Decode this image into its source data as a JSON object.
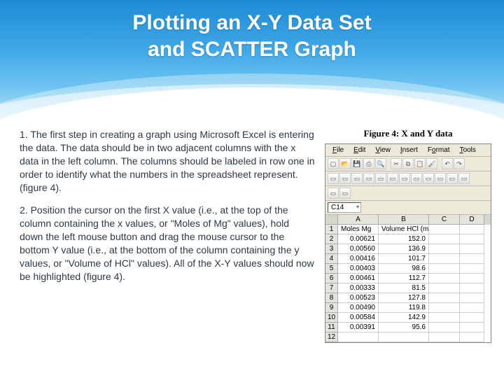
{
  "title_line1": "Plotting an X-Y Data Set",
  "title_line2": "and SCATTER Graph",
  "paragraphs": {
    "p1": "1. The first step in creating a graph using Microsoft Excel is entering the data. The data should be in two adjacent columns with the x data in the left column. The columns should be labeled in row one in order to identify what the numbers in the spreadsheet represent.(figure 4).",
    "p2": "2. Position the cursor on the first X value (i.e., at the top of the column containing the x values, or \"Moles of Mg\" values), hold down the left mouse button and drag the mouse cursor to the bottom Y value (i.e., at the bottom of the column containing the y values, or \"Volume of HCl\" values). All of the X-Y values should now be highlighted (figure 4)."
  },
  "figure_caption": "Figure 4: X and Y data",
  "excel": {
    "menu": [
      "File",
      "Edit",
      "View",
      "Insert",
      "Format",
      "Tools"
    ],
    "namebox": "C14",
    "columns": [
      "A",
      "B",
      "C",
      "D"
    ],
    "header_row": [
      "Moles Mg",
      "Volume HCl (ml)",
      "",
      ""
    ],
    "rows": [
      [
        "0.00621",
        "152.0",
        "",
        ""
      ],
      [
        "0.00560",
        "136.9",
        "",
        ""
      ],
      [
        "0.00416",
        "101.7",
        "",
        ""
      ],
      [
        "0.00403",
        "98.6",
        "",
        ""
      ],
      [
        "0.00461",
        "112.7",
        "",
        ""
      ],
      [
        "0.00333",
        "81.5",
        "",
        ""
      ],
      [
        "0.00523",
        "127.8",
        "",
        ""
      ],
      [
        "0.00490",
        "119.8",
        "",
        ""
      ],
      [
        "0.00584",
        "142.9",
        "",
        ""
      ],
      [
        "0.00391",
        "95.6",
        "",
        ""
      ]
    ]
  }
}
